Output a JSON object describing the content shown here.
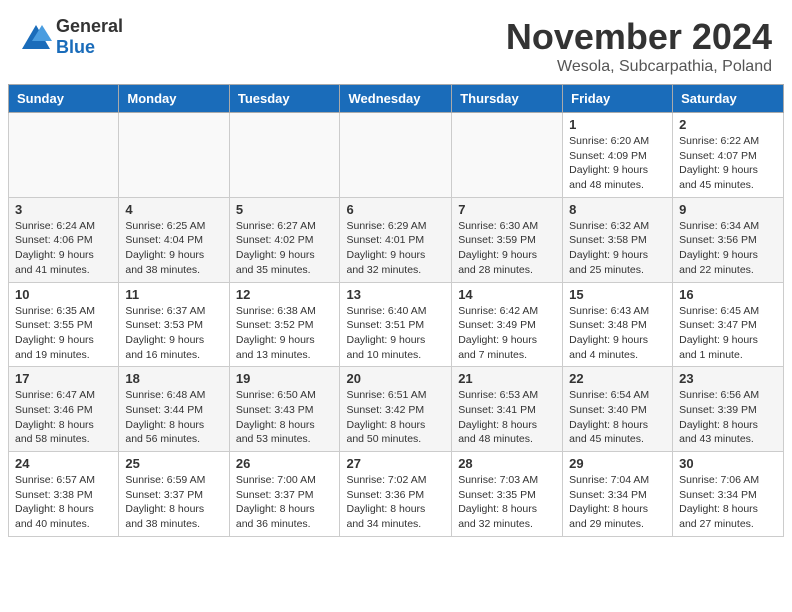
{
  "logo": {
    "general": "General",
    "blue": "Blue"
  },
  "title": "November 2024",
  "location": "Wesola, Subcarpathia, Poland",
  "days_header": [
    "Sunday",
    "Monday",
    "Tuesday",
    "Wednesday",
    "Thursday",
    "Friday",
    "Saturday"
  ],
  "weeks": [
    [
      {
        "day": "",
        "info": ""
      },
      {
        "day": "",
        "info": ""
      },
      {
        "day": "",
        "info": ""
      },
      {
        "day": "",
        "info": ""
      },
      {
        "day": "",
        "info": ""
      },
      {
        "day": "1",
        "info": "Sunrise: 6:20 AM\nSunset: 4:09 PM\nDaylight: 9 hours and 48 minutes."
      },
      {
        "day": "2",
        "info": "Sunrise: 6:22 AM\nSunset: 4:07 PM\nDaylight: 9 hours and 45 minutes."
      }
    ],
    [
      {
        "day": "3",
        "info": "Sunrise: 6:24 AM\nSunset: 4:06 PM\nDaylight: 9 hours and 41 minutes."
      },
      {
        "day": "4",
        "info": "Sunrise: 6:25 AM\nSunset: 4:04 PM\nDaylight: 9 hours and 38 minutes."
      },
      {
        "day": "5",
        "info": "Sunrise: 6:27 AM\nSunset: 4:02 PM\nDaylight: 9 hours and 35 minutes."
      },
      {
        "day": "6",
        "info": "Sunrise: 6:29 AM\nSunset: 4:01 PM\nDaylight: 9 hours and 32 minutes."
      },
      {
        "day": "7",
        "info": "Sunrise: 6:30 AM\nSunset: 3:59 PM\nDaylight: 9 hours and 28 minutes."
      },
      {
        "day": "8",
        "info": "Sunrise: 6:32 AM\nSunset: 3:58 PM\nDaylight: 9 hours and 25 minutes."
      },
      {
        "day": "9",
        "info": "Sunrise: 6:34 AM\nSunset: 3:56 PM\nDaylight: 9 hours and 22 minutes."
      }
    ],
    [
      {
        "day": "10",
        "info": "Sunrise: 6:35 AM\nSunset: 3:55 PM\nDaylight: 9 hours and 19 minutes."
      },
      {
        "day": "11",
        "info": "Sunrise: 6:37 AM\nSunset: 3:53 PM\nDaylight: 9 hours and 16 minutes."
      },
      {
        "day": "12",
        "info": "Sunrise: 6:38 AM\nSunset: 3:52 PM\nDaylight: 9 hours and 13 minutes."
      },
      {
        "day": "13",
        "info": "Sunrise: 6:40 AM\nSunset: 3:51 PM\nDaylight: 9 hours and 10 minutes."
      },
      {
        "day": "14",
        "info": "Sunrise: 6:42 AM\nSunset: 3:49 PM\nDaylight: 9 hours and 7 minutes."
      },
      {
        "day": "15",
        "info": "Sunrise: 6:43 AM\nSunset: 3:48 PM\nDaylight: 9 hours and 4 minutes."
      },
      {
        "day": "16",
        "info": "Sunrise: 6:45 AM\nSunset: 3:47 PM\nDaylight: 9 hours and 1 minute."
      }
    ],
    [
      {
        "day": "17",
        "info": "Sunrise: 6:47 AM\nSunset: 3:46 PM\nDaylight: 8 hours and 58 minutes."
      },
      {
        "day": "18",
        "info": "Sunrise: 6:48 AM\nSunset: 3:44 PM\nDaylight: 8 hours and 56 minutes."
      },
      {
        "day": "19",
        "info": "Sunrise: 6:50 AM\nSunset: 3:43 PM\nDaylight: 8 hours and 53 minutes."
      },
      {
        "day": "20",
        "info": "Sunrise: 6:51 AM\nSunset: 3:42 PM\nDaylight: 8 hours and 50 minutes."
      },
      {
        "day": "21",
        "info": "Sunrise: 6:53 AM\nSunset: 3:41 PM\nDaylight: 8 hours and 48 minutes."
      },
      {
        "day": "22",
        "info": "Sunrise: 6:54 AM\nSunset: 3:40 PM\nDaylight: 8 hours and 45 minutes."
      },
      {
        "day": "23",
        "info": "Sunrise: 6:56 AM\nSunset: 3:39 PM\nDaylight: 8 hours and 43 minutes."
      }
    ],
    [
      {
        "day": "24",
        "info": "Sunrise: 6:57 AM\nSunset: 3:38 PM\nDaylight: 8 hours and 40 minutes."
      },
      {
        "day": "25",
        "info": "Sunrise: 6:59 AM\nSunset: 3:37 PM\nDaylight: 8 hours and 38 minutes."
      },
      {
        "day": "26",
        "info": "Sunrise: 7:00 AM\nSunset: 3:37 PM\nDaylight: 8 hours and 36 minutes."
      },
      {
        "day": "27",
        "info": "Sunrise: 7:02 AM\nSunset: 3:36 PM\nDaylight: 8 hours and 34 minutes."
      },
      {
        "day": "28",
        "info": "Sunrise: 7:03 AM\nSunset: 3:35 PM\nDaylight: 8 hours and 32 minutes."
      },
      {
        "day": "29",
        "info": "Sunrise: 7:04 AM\nSunset: 3:34 PM\nDaylight: 8 hours and 29 minutes."
      },
      {
        "day": "30",
        "info": "Sunrise: 7:06 AM\nSunset: 3:34 PM\nDaylight: 8 hours and 27 minutes."
      }
    ]
  ]
}
